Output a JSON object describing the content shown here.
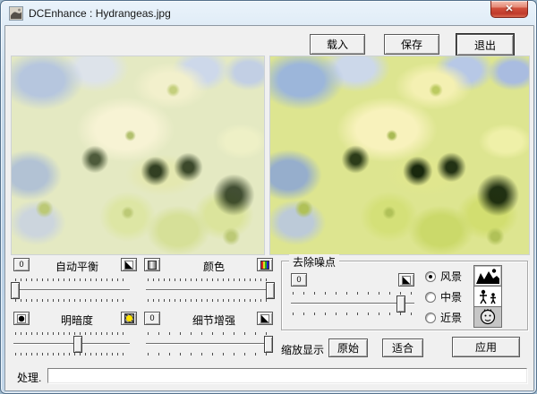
{
  "window": {
    "title": "DCEnhance : Hydrangeas.jpg",
    "close": "✕"
  },
  "toolbar": {
    "load": "载入",
    "save": "保存",
    "exit": "退出"
  },
  "controls": {
    "auto_balance": {
      "label": "自动平衡",
      "reset": "0",
      "value_pct": 3
    },
    "color": {
      "label": "颜色",
      "value_pct": 99
    },
    "brightness": {
      "label": "明暗度",
      "value_pct": 55
    },
    "detail": {
      "label": "细节增强",
      "reset": "0",
      "value_pct": 98
    }
  },
  "noise": {
    "title": "去除噪点",
    "reset": "0",
    "value_pct": 88,
    "options": [
      {
        "label": "风景",
        "selected": true
      },
      {
        "label": "中景",
        "selected": false
      },
      {
        "label": "近景",
        "selected": false
      }
    ]
  },
  "zoom_controls": {
    "label": "缩放显示",
    "original": "原始",
    "fit": "适合"
  },
  "apply_label": "应用",
  "status": {
    "label": "处理.",
    "progress_value": ""
  },
  "colors": {
    "close_button": "#c03a2b",
    "dialog_bg": "#f0f0f0",
    "frame_glass": "#b9d0e6"
  }
}
